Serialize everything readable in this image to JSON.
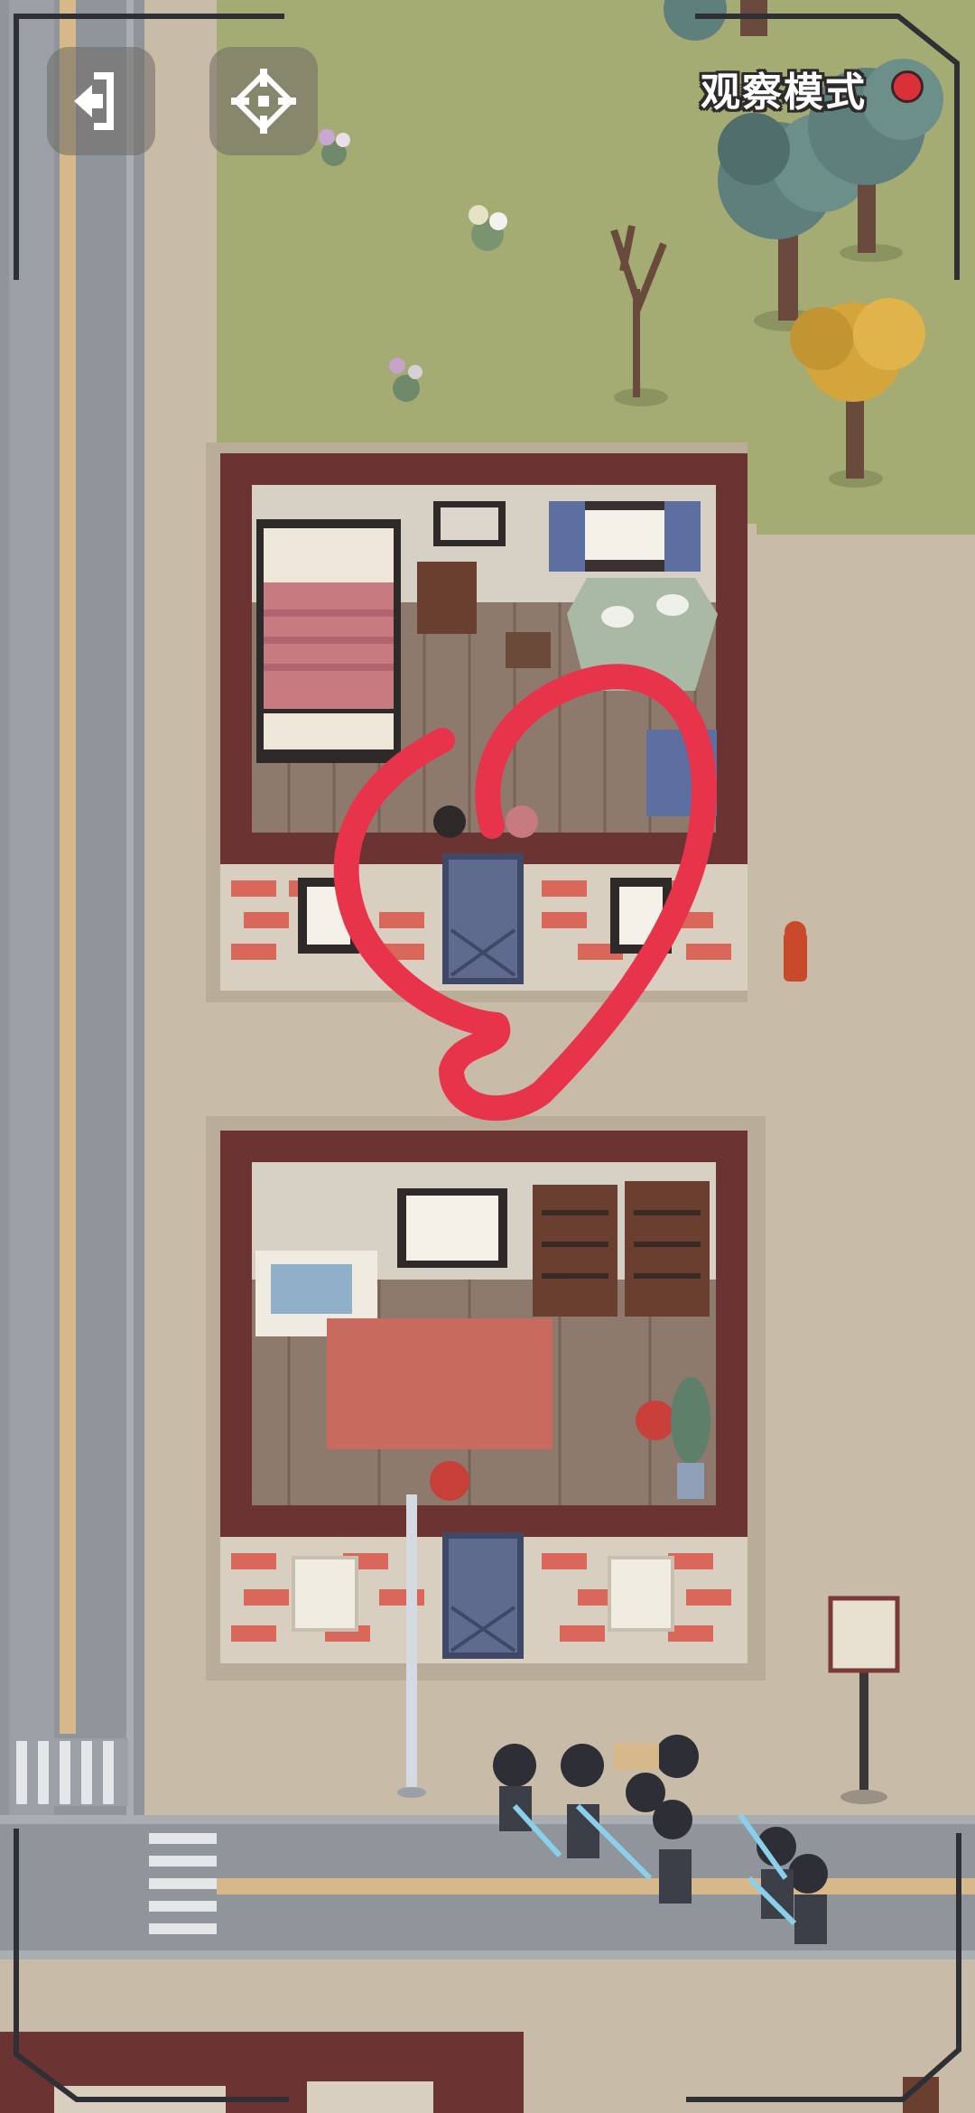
{
  "hud": {
    "mode_label": "观察模式",
    "exit_icon": "exit-door-icon",
    "focus_icon": "crosshair-focus-icon",
    "record_indicator_color": "#d9303a"
  },
  "annotation": {
    "color": "#e8344a",
    "shape": "hand-drawn circle"
  },
  "palette": {
    "grass": "#a4ac74",
    "sidewalk": "#c8bba8",
    "road": "#8f959a",
    "wall_dark": "#6b3332",
    "brick": "#d9675a",
    "floor": "#8e7a6c",
    "door": "#5e6b8e"
  }
}
